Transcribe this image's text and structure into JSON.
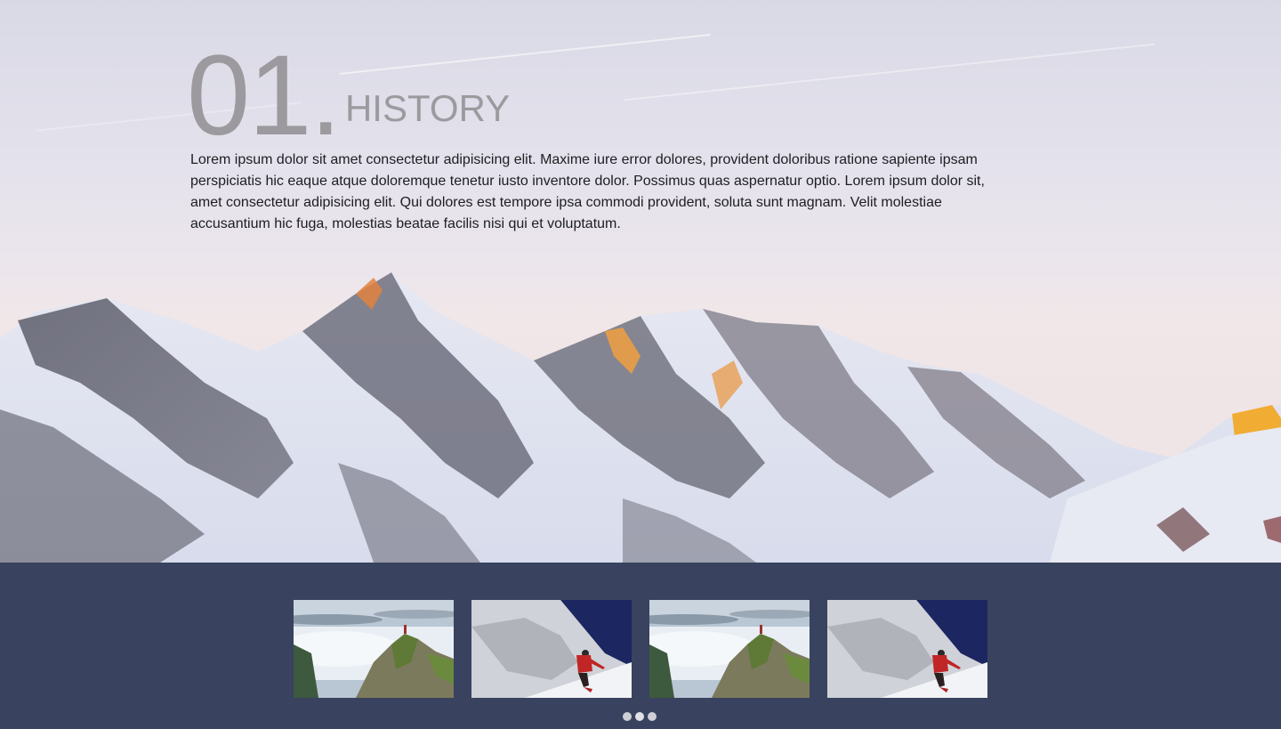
{
  "section": {
    "number": "01.",
    "title": "HISTORY",
    "text": "Lorem ipsum dolor sit amet consectetur adipisicing elit. Maxime iure error dolores, provident doloribus ratione sapiente ipsam perspiciatis hic eaque atque doloremque tenetur iusto inventore dolor. Possimus quas aspernatur optio. Lorem ipsum dolor sit, amet consectetur adipisicing elit. Qui dolores est tempore ipsa commodi provident, soluta sunt magnam. Velit molestiae accusantium hic fuga, molestias beatae facilis nisi qui et voluptatum."
  },
  "hero": {
    "image": "snowy-mountain-range"
  },
  "gallery": {
    "thumbnails": [
      {
        "image": "hiker-on-cliff-above-clouds"
      },
      {
        "image": "climber-on-snowy-slope"
      },
      {
        "image": "hiker-on-cliff-above-clouds"
      },
      {
        "image": "climber-on-snowy-slope"
      }
    ],
    "pagination_count": 3,
    "active_page": 2
  },
  "colors": {
    "strip_background": "#39425e",
    "heading_gray": "#9c9a9e",
    "body_text": "#1d1d22"
  }
}
